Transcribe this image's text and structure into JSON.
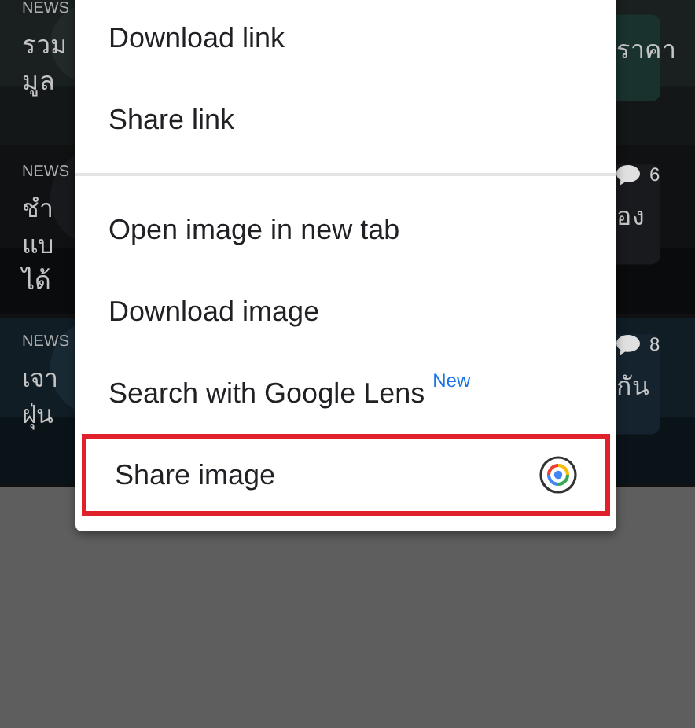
{
  "news_cards": [
    {
      "tag": "NEWS",
      "left_lines": [
        "รวม",
        "มูล"
      ],
      "right_lines": [
        "ราคา"
      ]
    },
    {
      "tag": "NEWS",
      "left_lines": [
        "ชำ",
        "แบ",
        "ได้"
      ],
      "right_lines": [
        "อง"
      ],
      "comments": "6"
    },
    {
      "tag": "NEWS",
      "left_lines": [
        "เจา",
        "ฝุ่น"
      ],
      "right_lines": [
        "กัน"
      ],
      "comments": "8"
    }
  ],
  "context_menu": {
    "groups": [
      [
        {
          "label": "Download link",
          "kind": "plain",
          "highlighted": false
        },
        {
          "label": "Share link",
          "kind": "plain",
          "highlighted": false
        }
      ],
      [
        {
          "label": "Open image in new tab",
          "kind": "plain",
          "highlighted": false
        },
        {
          "label": "Download image",
          "kind": "plain",
          "highlighted": false
        },
        {
          "label": "Search with Google Lens",
          "kind": "plain",
          "badge": "New",
          "highlighted": false
        },
        {
          "label": "Share image",
          "kind": "with_icon",
          "highlighted": true
        }
      ]
    ]
  }
}
